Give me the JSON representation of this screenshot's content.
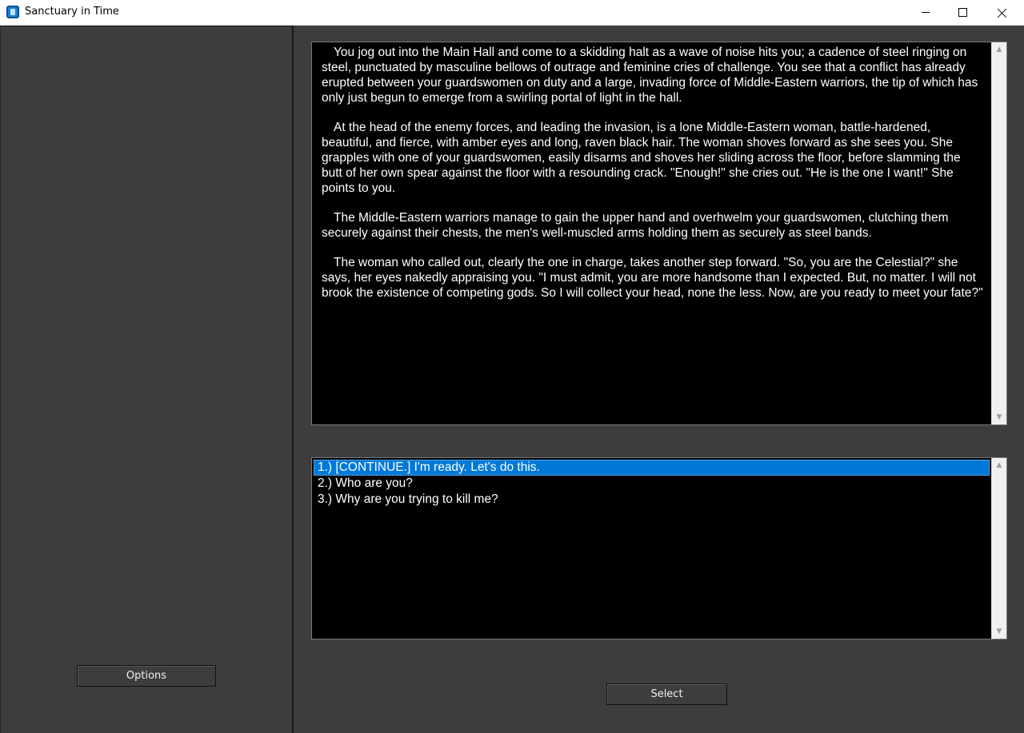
{
  "window": {
    "title": "Sanctuary in Time",
    "app_icon": "app-icon"
  },
  "left_panel": {
    "options_label": "Options"
  },
  "story": {
    "paragraphs": [
      "You jog out into the Main Hall and come to a skidding halt as a wave of noise hits you; a cadence of steel ringing on steel, punctuated by masculine bellows of outrage and feminine cries of challenge. You see that a conflict has already erupted between your guardswomen on duty and a large, invading force of Middle-Eastern warriors, the tip of which has only just begun to emerge from a swirling portal of light in the hall.",
      "At the head of the enemy forces, and leading the invasion, is a lone Middle-Eastern woman, battle-hardened, beautiful, and fierce, with amber eyes and long, raven black hair. The woman shoves forward as she sees you. She grapples with one of your guardswomen, easily disarms and shoves her sliding across the floor, before slamming the butt of her own spear against the floor with a resounding crack. \"Enough!\" she cries out. \"He is the one I want!\" She points to you.",
      "The Middle-Eastern warriors manage to gain the upper hand and overhwelm your guardswomen, clutching them securely against their chests, the men's well-muscled arms holding them as securely as steel bands.",
      "The woman who called out, clearly the one in charge, takes another step forward. \"So, you are the Celestial?\" she says, her eyes nakedly appraising you. \"I must admit, you are more handsome than I expected. But, no matter. I will not brook the existence of competing gods. So I will collect your head, none the less. Now, are you ready to meet your fate?\""
    ]
  },
  "choices": {
    "items": [
      "1.) [CONTINUE.] I'm ready. Let's do this.",
      "2.) Who are you?",
      "3.) Why are you trying to kill me?"
    ],
    "selected_index": 0
  },
  "actions": {
    "select_label": "Select"
  },
  "colors": {
    "background": "#3d3d3d",
    "text_area": "#000000",
    "selection": "#0078d7",
    "text": "#ffffff"
  }
}
